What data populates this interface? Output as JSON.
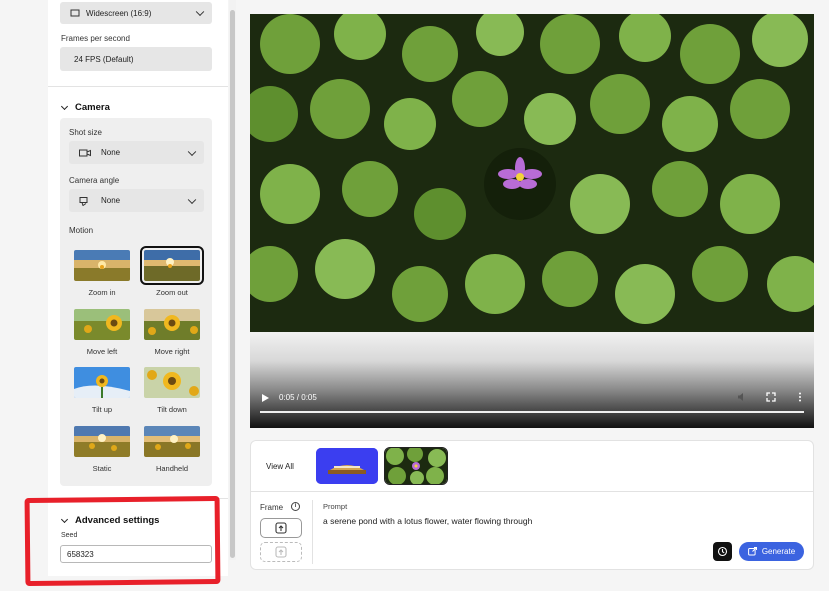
{
  "settings": {
    "aspect_ratio": {
      "value": "Widescreen (16:9)"
    },
    "fps": {
      "label": "Frames per second",
      "value": "24 FPS (Default)"
    }
  },
  "camera": {
    "title": "Camera",
    "shot_size": {
      "label": "Shot size",
      "value": "None"
    },
    "camera_angle": {
      "label": "Camera angle",
      "value": "None"
    },
    "motion": {
      "label": "Motion",
      "options": [
        {
          "label": "Zoom in",
          "selected": false
        },
        {
          "label": "Zoom out",
          "selected": true
        },
        {
          "label": "Move left",
          "selected": false
        },
        {
          "label": "Move right",
          "selected": false
        },
        {
          "label": "Tilt up",
          "selected": false
        },
        {
          "label": "Tilt down",
          "selected": false
        },
        {
          "label": "Static",
          "selected": false
        },
        {
          "label": "Handheld",
          "selected": false
        }
      ]
    }
  },
  "advanced": {
    "title": "Advanced settings",
    "seed_label": "Seed",
    "seed_value": "658323"
  },
  "video": {
    "time": "0:05 / 0:05",
    "progress": 1.0
  },
  "composer": {
    "view_all": "View All",
    "frame_label": "Frame",
    "prompt_label": "Prompt",
    "prompt_text": "a serene pond with a lotus flower, water flowing through",
    "generate_label": "Generate"
  },
  "colors": {
    "accent": "#3b63e0",
    "annotation": "#e8202a"
  }
}
